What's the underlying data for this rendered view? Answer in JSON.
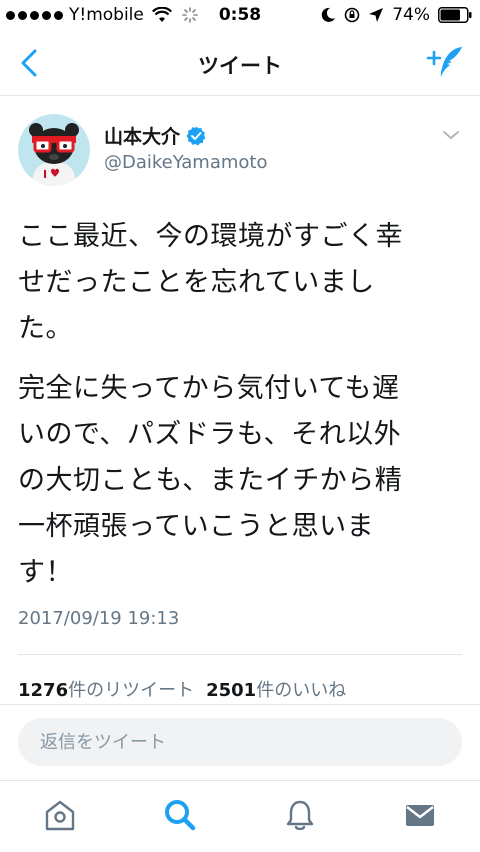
{
  "status_bar": {
    "carrier": "Y!mobile",
    "time": "0:58",
    "battery": "74%"
  },
  "nav": {
    "title": "ツイート",
    "back_icon": "chevron-left-icon",
    "compose_icon": "compose-tweet-icon"
  },
  "tweet": {
    "user_name": "山本大介",
    "handle": "@DaikeYamamoto",
    "paragraphs": [
      "ここ最近、今の環境がすごく幸\nせだったことを忘れていまし\nた。",
      "完全に失ってから気付いても遅\nいので、パズドラも、それ以外\nの大切ことも、またイチから精\n一杯頑張っていこうと思いま\nす！"
    ],
    "timestamp": "2017/09/19 19:13",
    "retweet_count": "1276",
    "retweet_label": "件のリツイート",
    "like_count": "2501",
    "like_label": "件のいいね"
  },
  "reply": {
    "placeholder": "返信をツイート"
  },
  "tabs": [
    "home-icon",
    "search-icon",
    "notifications-icon",
    "messages-icon"
  ],
  "colors": {
    "accent": "#1da1f2",
    "secondary_text": "#657786",
    "icon_gray": "#657786"
  }
}
